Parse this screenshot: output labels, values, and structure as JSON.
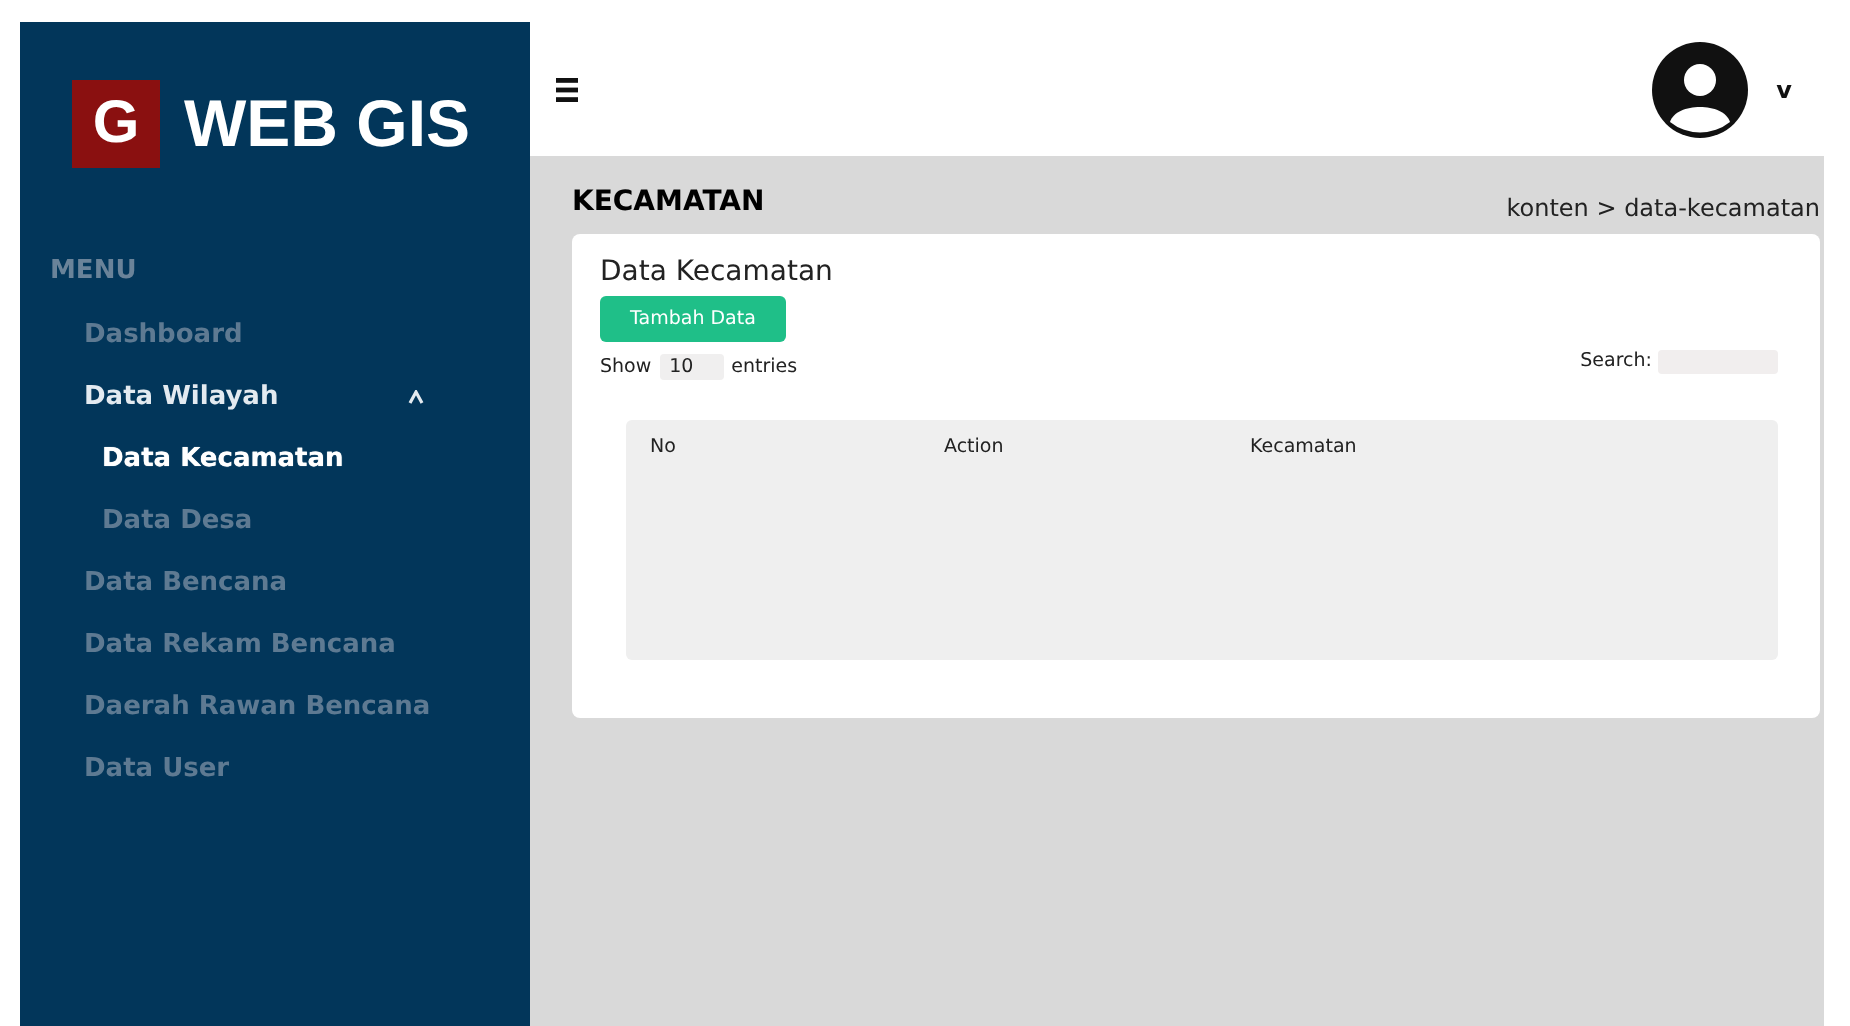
{
  "logo": {
    "mark": "G",
    "text": "WEB GIS"
  },
  "sidebar": {
    "heading": "MENU",
    "items": [
      {
        "label": "Dashboard",
        "selected": false
      },
      {
        "label": "Data Wilayah",
        "selected": false,
        "expanded": true,
        "children": [
          {
            "label": "Data Kecamatan",
            "selected": true
          },
          {
            "label": "Data Desa",
            "selected": false
          }
        ]
      },
      {
        "label": "Data Bencana",
        "selected": false
      },
      {
        "label": "Data Rekam Bencana",
        "selected": false
      },
      {
        "label": "Daerah Rawan Bencana",
        "selected": false
      },
      {
        "label": "Data User",
        "selected": false
      }
    ]
  },
  "topbar": {
    "user_caret": "v"
  },
  "page": {
    "title": "KECAMATAN",
    "breadcrumb": "konten > data-kecamatan"
  },
  "card": {
    "title": "Data Kecamatan",
    "add_button": "Tambah Data",
    "show_label": "Show",
    "entries_value": "10",
    "entries_label": "entries",
    "search_label": "Search:",
    "table": {
      "columns": [
        "No",
        "Action",
        "Kecamatan"
      ]
    }
  }
}
